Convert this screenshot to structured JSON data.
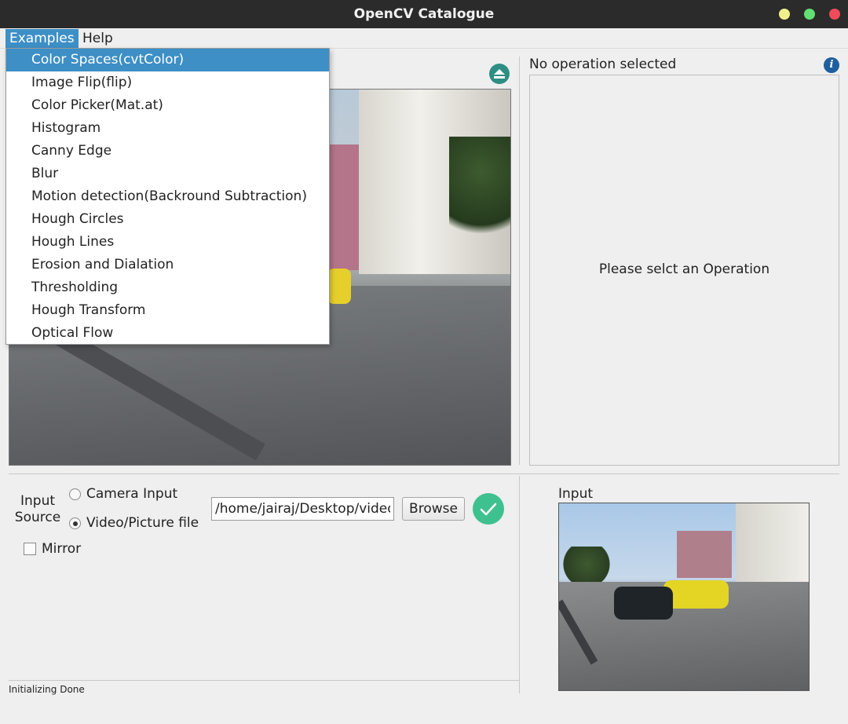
{
  "window": {
    "title": "OpenCV Catalogue"
  },
  "menubar": {
    "examples": "Examples",
    "help": "Help"
  },
  "examples_menu": [
    "Color Spaces(cvtColor)",
    "Image Flip(flip)",
    "Color Picker(Mat.at)",
    "Histogram",
    "Canny Edge",
    "Blur",
    "Motion detection(Backround Subtraction)",
    "Hough Circles",
    "Hough Lines",
    "Erosion and Dialation",
    "Thresholding",
    "Hough Transform",
    "Optical Flow"
  ],
  "operation_panel": {
    "title": "No operation selected",
    "placeholder": "Please selct an Operation",
    "info_icon": "i"
  },
  "input_source": {
    "label": "Input Source",
    "camera_option": "Camera Input",
    "file_option": "Video/Picture file",
    "selected": "file",
    "mirror_label": "Mirror",
    "mirror_checked": false,
    "path_value": "/home/jairaj/Desktop/video",
    "browse_label": "Browse"
  },
  "input_preview": {
    "label": "Input"
  },
  "status": {
    "text": "Initializing Done"
  },
  "colors": {
    "accent": "#3d8fc6",
    "ok_button": "#3ec08f",
    "eject_button": "#2e8e83",
    "titlebar": "#2b2b2b"
  },
  "icons": {
    "eject": "eject-icon",
    "info": "info-icon",
    "confirm": "checkmark-icon"
  }
}
